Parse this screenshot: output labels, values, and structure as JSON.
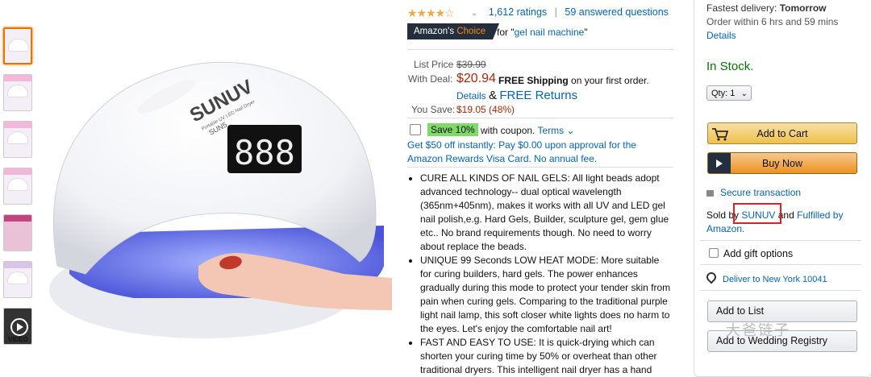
{
  "rating": {
    "stars": "★★★★☆",
    "count": "1,612 ratings",
    "answered": "59 answered questions",
    "separator": "|"
  },
  "choice_badge": {
    "prefix": "Amazon's",
    "choice": "Choice",
    "for_text": "for \"",
    "query": "gel nail machine",
    "close": "\""
  },
  "pricing": {
    "list_label": "List Price",
    "list_price": "$39.99",
    "deal_label": "With Deal:",
    "deal_price": "$20.94",
    "free_shipping": "FREE Shipping",
    "shipping_note": "on your first order.",
    "details": "Details",
    "amp": "&",
    "free_returns": "FREE Returns",
    "save_label": "You Save:",
    "save_value": "$19.05 (48%)"
  },
  "coupon": {
    "badge": "Save 10%",
    "text": "with coupon.",
    "terms": "Terms ⌄"
  },
  "rewards": "Get $50 off instantly: Pay $0.00 upon approval for the Amazon Rewards Visa Card. No annual fee.",
  "bullets": [
    "CURE ALL KINDS OF NAIL GELS: All light beads adopt advanced technology-- dual optical wavelength (365nm+405nm), makes it works with all UV and LED gel nail polish,e.g. Hard Gels, Builder, sculpture gel, gem glue etc.. No brand requirements though. No need to worry about replace the beads.",
    "UNIQUE 99 Seconds LOW HEAT MODE: More suitable for curing builders, hard gels. The power enhances gradually during this mode to protect your tender skin from pain when curing gels. Comparing to the traditional purple light nail lamp, this soft closer white lights does no harm to the eyes. Let's enjoy the comfortable nail art!",
    "FAST AND EASY TO USE: It is quick-drying which can shorten your curing time by 50% or overheat than other traditional dryers. This intelligent nail dryer has a hand"
  ],
  "product_image": {
    "brand": "SUNUV",
    "model": "SUN5",
    "subtitle": "Portable UV LED Nail Dryer",
    "display": "888"
  },
  "thumbnails": {
    "video_label": "VIDEO"
  },
  "buybox": {
    "fastest_label": "Fastest delivery:",
    "fastest_value": "Tomorrow",
    "order_within": "Order within 6 hrs and 59 mins",
    "details": "Details",
    "stock": "In Stock.",
    "qty": "Qty: 1",
    "add_to_cart": "Add to Cart",
    "buy_now": "Buy Now",
    "secure": "Secure transaction",
    "sold_by": "Sold by",
    "seller": "SUNUV",
    "and": "and",
    "fulfilled": "Fulfilled by Amazon.",
    "gift": "Add gift options",
    "deliver": "Deliver to New York 10041",
    "add_list": "Add to List",
    "add_registry": "Add to Wedding Registry"
  },
  "watermark": "大爸链子",
  "colors": {
    "link": "#0066c0",
    "price": "#b12704",
    "stock": "#007600",
    "highlight": "#e41e26"
  }
}
